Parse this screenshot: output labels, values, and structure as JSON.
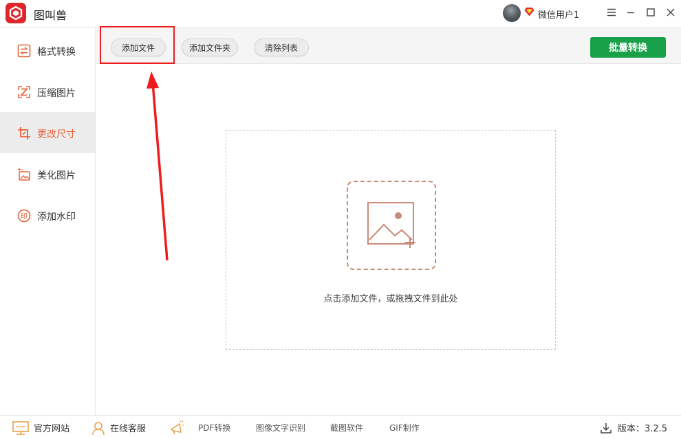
{
  "app": {
    "title": "图叫兽",
    "icon": "app-logo-icon"
  },
  "user": {
    "name": "微信用户1",
    "vip_icon": "diamond-icon",
    "avatar": "user-avatar"
  },
  "window_controls": [
    "menu-icon",
    "minimize-icon",
    "maximize-icon",
    "close-icon"
  ],
  "sidebar": {
    "items": [
      {
        "label": "格式转换",
        "icon": "convert-icon",
        "active": false
      },
      {
        "label": "压缩图片",
        "icon": "compress-icon",
        "active": false
      },
      {
        "label": "更改尺寸",
        "icon": "resize-icon",
        "active": true
      },
      {
        "label": "美化图片",
        "icon": "beautify-icon",
        "active": false
      },
      {
        "label": "添加水印",
        "icon": "watermark-icon",
        "active": false
      }
    ]
  },
  "toolbar": {
    "add_file": "添加文件",
    "add_folder": "添加文件夹",
    "clear_list": "清除列表",
    "batch_convert": "批量转换"
  },
  "dropzone": {
    "hint": "点击添加文件，或拖拽文件到此处",
    "icon": "image-add-icon"
  },
  "footer": {
    "official_site": "官方网站",
    "online_service": "在线客服",
    "links": [
      "PDF转换",
      "图像文字识别",
      "截图软件",
      "GIF制作"
    ],
    "version": "版本：3.2.5"
  },
  "colors": {
    "accent": "#e8613a",
    "primary_button": "#19a14a",
    "annotation": "#ee1c1c",
    "logo": "#e0262a"
  }
}
